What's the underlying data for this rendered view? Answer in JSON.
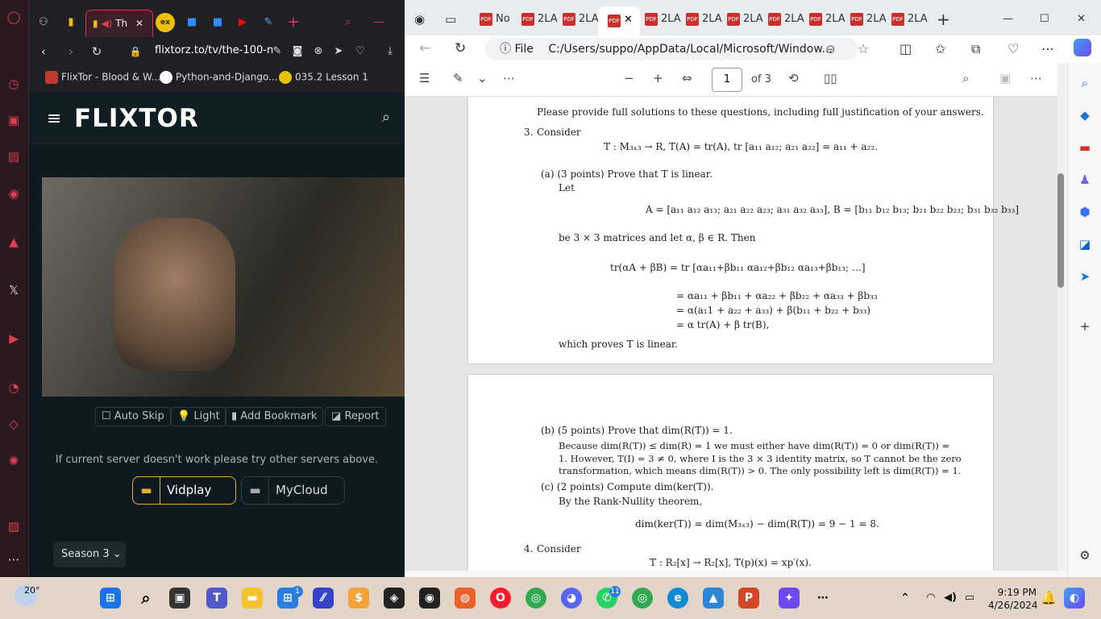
{
  "opera": {
    "tabs": {
      "active": "Th",
      "close": "✕",
      "new": "+"
    },
    "address": {
      "url": "flixtorz.to/tv/the-100-n"
    },
    "bookmarks": [
      "FlixTor - Blood & W...",
      "Python-and-Django...",
      "035.2 Lesson 1"
    ]
  },
  "flixtor": {
    "logo": "FLIXTOR",
    "controls": [
      "Auto Skip",
      "Light",
      "Add Bookmark",
      "Report"
    ],
    "notice": "If current server doesn't work please try other servers above.",
    "servers": [
      "Vidplay",
      "MyCloud"
    ],
    "season": "Season 3",
    "accent": "#e4b12f"
  },
  "edge": {
    "tabs": [
      "No",
      "2LA",
      "2LA",
      "2LA",
      "2LA",
      "2LA",
      "2LA",
      "2LA",
      "2LA",
      "2LA"
    ],
    "file_label": "File",
    "url": "C:/Users/suppo/AppData/Local/Microsoft/Window...",
    "page": {
      "current": "1",
      "of": "of 3"
    }
  },
  "pdf": {
    "intro": "Please provide full solutions to these questions, including full justification of your answers.",
    "q3": {
      "num": "3.",
      "consider": "Consider",
      "def": "T : M₃ₓ₃ → R,   T(A) = tr(A),   tr [a₁₁ a₁₂; a₂₁ a₂₂] = a₁₁ + a₂₂.",
      "a_head": "(a)  (3 points) Prove that T is linear.",
      "let": "Let",
      "mats": "A = [a₁₁ a₁₂ a₁₃; a₂₁ a₂₂ a₂₃; a₃₁ a₃₂ a₃₃],   B = [b₁₁ b₁₂ b₁₃; b₂₁ b₂₂ b₂₃; b₃₁ b₃₂ b₃₃]",
      "be": "be 3 × 3 matrices and let α, β ∈ R. Then",
      "l1": "tr(αA + βB)  =  tr [αa₁₁+βb₁₁  αa₁₂+βb₁₂  αa₁₃+βb₁₃; …]",
      "l2": "=  αa₁₁ + βb₁₁ + αa₂₂ + βb₂₂ + αa₃₃ + βb₃₃",
      "l3": "=  α(a₁1 + a₂₂ + a₃₃) + β(b₁₁ + b₂₂ + b₃₃)",
      "l4": "=  α tr(A) + β tr(B),",
      "proves": "which proves T is linear."
    },
    "b": {
      "head": "(b)  (5 points) Prove that dim(R(T)) = 1.",
      "p1": "Because dim(R(T)) ≤ dim(R) = 1 we must either have dim(R(T)) = 0 or dim(R(T)) =",
      "p2": "1. However, T(I) = 3 ≠ 0, where I is the 3 × 3 identity matrix, so T cannot be the zero",
      "p3": "transformation, which means dim(R(T)) > 0. The only possibility left is dim(R(T)) = 1."
    },
    "c": {
      "head": "(c)  (2 points) Compute dim(ker(T)).",
      "by": "By the Rank-Nullity theorem,",
      "eq": "dim(ker(T)) = dim(M₃ₓ₃) − dim(R(T)) = 9 − 1 = 8."
    },
    "q4": {
      "num": "4.",
      "consider": "Consider",
      "def": "T : R₂[x] → R₂[x],      T(p)(x) = xp′(x)."
    }
  },
  "taskbar": {
    "weather": "20°",
    "time": "9:19 PM",
    "date": "4/26/2024",
    "badges": [
      "1",
      "11"
    ]
  }
}
